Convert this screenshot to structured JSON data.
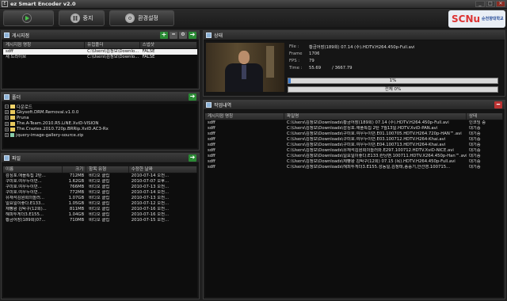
{
  "window": {
    "title": "ez Smart Encoder v2.0",
    "minimize": "_",
    "maximize": "□",
    "close": "✕"
  },
  "toolbar": {
    "play_label": "",
    "pause_label": "중지",
    "settings_label": "환경설정"
  },
  "logo": {
    "text": "SCNu",
    "sub": "순천향대학교"
  },
  "watch_panel": {
    "title": "게시지점",
    "columns": [
      "게시지점 명칭",
      "유첩폴더",
      "스넵샷"
    ],
    "rows": [
      [
        "sdff",
        "C:\\Users\\김정모\\Downlo...",
        "FALSE"
      ],
      [
        "새 드라이브",
        "C:\\Users\\김정모\\Downlo...",
        "FALSE"
      ]
    ]
  },
  "folder_panel": {
    "title": "폴더",
    "items": [
      {
        "label": "다운로드",
        "type": "folder-open",
        "expanded": true
      },
      {
        "label": "Gkysoft.DRM.Removal.v1.0.0",
        "type": "folder"
      },
      {
        "label": "Pruna",
        "type": "folder"
      },
      {
        "label": "The.A-Team.2010.R5.LiNE.XviD-VISION",
        "type": "folder"
      },
      {
        "label": "The.Crazies.2010.720p.BRRip.XviD.AC3-Rx",
        "type": "folder"
      },
      {
        "label": "jquery-image-gallery-source.zip",
        "type": "file"
      }
    ]
  },
  "file_panel": {
    "title": "파일",
    "columns": [
      "이름",
      "크기",
      "항목 유형",
      "수정한 날짜"
    ],
    "rows": [
      [
        "감싱포.애플특집 2탄...",
        "712MB",
        "비디오 클립",
        "2010-07-14 오전..."
      ],
      [
        "구미호.여우누이뎐...",
        "1.62GB",
        "비디오 클립",
        "2010-07-07 오후..."
      ],
      [
        "구미호.여우누이뎐...",
        "766MB",
        "비디오 클립",
        "2010-07-13 오전..."
      ],
      [
        "구미호.여우누이뎐...",
        "772MB",
        "비디오 클립",
        "2010-07-14 오전..."
      ],
      [
        "유재석김원희의놀러...",
        "1.07GB",
        "비디오 클립",
        "2010-07-13 오전..."
      ],
      [
        "일요일이좋다.E133...",
        "1.05GB",
        "비디오 클립",
        "2010-07-12 오전..."
      ],
      [
        "재빵왕 김탁구(12회)...",
        "811MB",
        "비디오 클립",
        "2010-07-16 오전..."
      ],
      [
        "해피투게더3.E155...",
        "1.04GB",
        "비디오 클립",
        "2010-07-16 오전..."
      ],
      [
        "황금어장(189회)07...",
        "710MB",
        "비디오 클립",
        "2010-07-15 오전..."
      ]
    ]
  },
  "status_panel": {
    "title": "상태",
    "file_key": "File :",
    "file_val": "황금어장(189회) 07.14 (수).HDTV.H264.450p-Full.avi",
    "frame_key": "Frame",
    "frame_val": "1706",
    "fps_key": "FPS :",
    "fps_val": "79",
    "time_key": "Time :",
    "time_val": "55.69",
    "time_total": "/  3667.79",
    "progress_label": "1%",
    "progress": 0.01,
    "overall_label": "전체 0%",
    "overall": 0.0
  },
  "jobs_panel": {
    "title": "작업내역",
    "columns": [
      "게시지점 명칭",
      "파일명",
      "상태"
    ],
    "rows": [
      [
        "sdff",
        "C:\\Users\\김정모\\Downloads\\황금어장(189회) 07.14 (수).HDTV.H264.450p-Full.avi",
        "인코딩 중"
      ],
      [
        "sdff",
        "C:\\Users\\김정모\\Downloads\\감싱포.애플특집 2탄 7월13일.HDTV.XviD-PAN.avi",
        "대기중"
      ],
      [
        "sdff",
        "C:\\Users\\김정모\\Downloads\\구미호.여우누이뎐.E01.100705.HDTV.H264.720p-HAN™.avi",
        "대기중"
      ],
      [
        "sdff",
        "C:\\Users\\김정모\\Downloads\\구미호.여우누이뎐.E03.100712.HDTV.H264-Khai.avi",
        "대기중"
      ],
      [
        "sdff",
        "C:\\Users\\김정모\\Downloads\\구미호.여우누이뎐.E04.100713.HDTV.H264-Khai.avi",
        "대기중"
      ],
      [
        "sdff",
        "C:\\Users\\김정모\\Downloads\\유재석김원희의놀러와.E297.100712.HDTV.XviD-NICE.avi",
        "대기중"
      ],
      [
        "sdff",
        "C:\\Users\\김정모\\Downloads\\일요일이좋다.E133.런닝맨.100711.HDTV.X264.450p-Han™.avi",
        "대기중"
      ],
      [
        "sdff",
        "C:\\Users\\김정모\\Downloads\\제빵왕 김탁구(12회) 07.15 (목).HDTV.H264.450p-Full.avi",
        "대기중"
      ],
      [
        "sdff",
        "C:\\Users\\김정모\\Downloads\\해피투게더3.E155.성동일,김정태,송중기,안선영.100715...",
        "대기중"
      ]
    ]
  }
}
